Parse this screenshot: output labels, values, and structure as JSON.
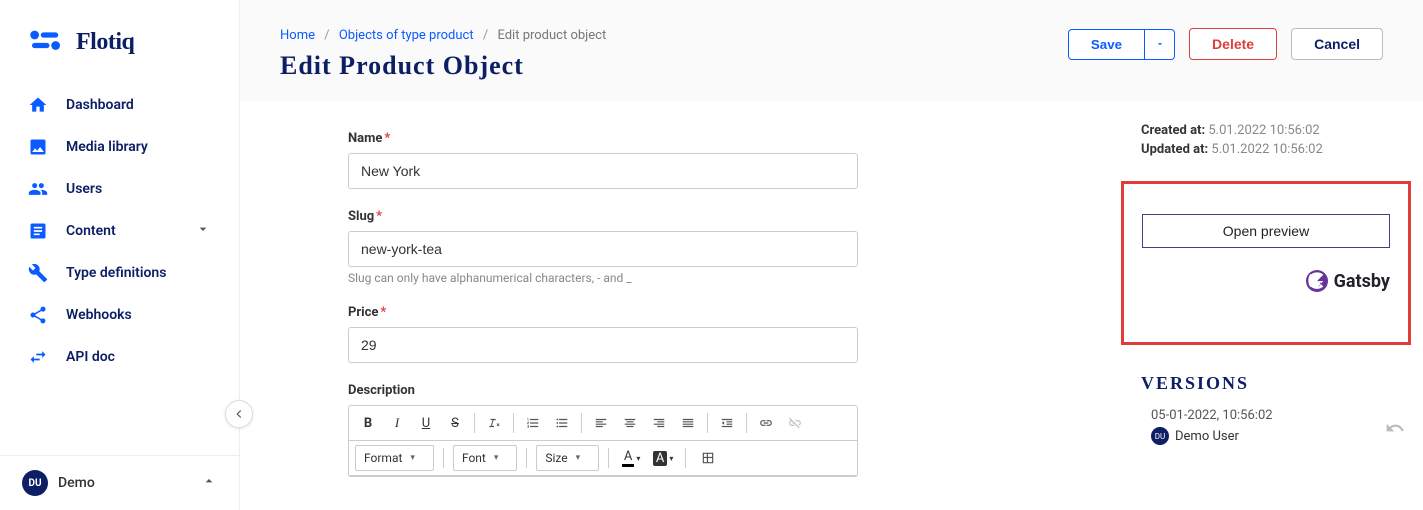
{
  "brand": {
    "name": "Flotiq"
  },
  "sidebar": {
    "items": [
      {
        "label": "Dashboard"
      },
      {
        "label": "Media library"
      },
      {
        "label": "Users"
      },
      {
        "label": "Content"
      },
      {
        "label": "Type definitions"
      },
      {
        "label": "Webhooks"
      },
      {
        "label": "API doc"
      }
    ],
    "user": {
      "initials": "DU",
      "name": "Demo"
    }
  },
  "breadcrumb": {
    "home": "Home",
    "objects": "Objects of type product",
    "current": "Edit product object"
  },
  "page_title": "Edit Product Object",
  "actions": {
    "save": "Save",
    "delete": "Delete",
    "cancel": "Cancel"
  },
  "form": {
    "name_label": "Name",
    "name_value": "New York",
    "slug_label": "Slug",
    "slug_value": "new-york-tea",
    "slug_hint": "Slug can only have alphanumerical characters, - and _",
    "price_label": "Price",
    "price_value": "29",
    "desc_label": "Description",
    "toolbar_format": "Format",
    "toolbar_font": "Font",
    "toolbar_size": "Size",
    "toolbar_bold": "B",
    "toolbar_italic": "I",
    "toolbar_underline": "U",
    "toolbar_strike": "S",
    "toolbar_color_a": "A",
    "toolbar_bg_a": "A"
  },
  "meta": {
    "created_label": "Created at:",
    "created_value": "5.01.2022 10:56:02",
    "updated_label": "Updated at:",
    "updated_value": "5.01.2022 10:56:02"
  },
  "preview": {
    "button": "Open preview",
    "brand": "Gatsby"
  },
  "versions": {
    "heading": "VERSIONS",
    "items": [
      {
        "date": "05-01-2022, 10:56:02",
        "user": "Demo User",
        "initials": "DU"
      }
    ]
  }
}
